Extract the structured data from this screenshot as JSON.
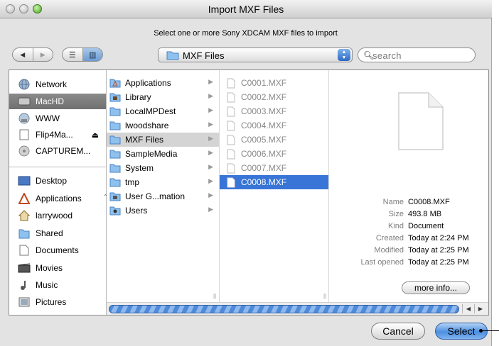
{
  "window": {
    "title": "Import MXF Files"
  },
  "message": "Select one or more Sony XDCAM MXF files to import",
  "toolbar": {
    "back_icon": "back-arrow-icon",
    "forward_icon": "forward-arrow-icon",
    "view_list_icon": "list-view-icon",
    "view_column_icon": "column-view-icon",
    "current_folder": "MXF Files",
    "search_placeholder": "search"
  },
  "sidebar": {
    "devices": [
      {
        "label": "Network",
        "icon": "network-globe-icon"
      },
      {
        "label": "MacHD",
        "icon": "hard-drive-icon",
        "selected": true
      },
      {
        "label": "WWW",
        "icon": "network-volume-icon"
      },
      {
        "label": "Flip4Ma...",
        "icon": "disk-image-icon",
        "eject": "⏏"
      },
      {
        "label": "CAPTUREM...",
        "icon": "drive-icon"
      }
    ],
    "places": [
      {
        "label": "Desktop",
        "icon": "desktop-icon"
      },
      {
        "label": "Applications",
        "icon": "applications-icon"
      },
      {
        "label": "larrywood",
        "icon": "home-icon"
      },
      {
        "label": "Shared",
        "icon": "folder-icon"
      },
      {
        "label": "Documents",
        "icon": "documents-icon"
      },
      {
        "label": "Movies",
        "icon": "movies-icon"
      },
      {
        "label": "Music",
        "icon": "music-icon"
      },
      {
        "label": "Pictures",
        "icon": "pictures-icon"
      }
    ]
  },
  "column1": [
    {
      "label": "Applications"
    },
    {
      "label": "Library"
    },
    {
      "label": "LocalMPDest"
    },
    {
      "label": "lwoodshare"
    },
    {
      "label": "MXF Files",
      "selected": true
    },
    {
      "label": "SampleMedia"
    },
    {
      "label": "System"
    },
    {
      "label": "tmp"
    },
    {
      "label": "User G...mation"
    },
    {
      "label": "Users"
    }
  ],
  "column2": [
    {
      "label": "C0001.MXF"
    },
    {
      "label": "C0002.MXF"
    },
    {
      "label": "C0003.MXF"
    },
    {
      "label": "C0004.MXF"
    },
    {
      "label": "C0005.MXF"
    },
    {
      "label": "C0006.MXF"
    },
    {
      "label": "C0007.MXF"
    },
    {
      "label": "C0008.MXF",
      "selected": true
    }
  ],
  "preview": {
    "info": [
      {
        "key": "Name",
        "value": "C0008.MXF"
      },
      {
        "key": "Size",
        "value": "493.8 MB"
      },
      {
        "key": "Kind",
        "value": "Document"
      },
      {
        "key": "Created",
        "value": "Today at 2:24 PM"
      },
      {
        "key": "Modified",
        "value": "Today at 2:25 PM"
      },
      {
        "key": "Last opened",
        "value": "Today at 2:25 PM"
      }
    ],
    "more_info_label": "more info..."
  },
  "buttons": {
    "cancel": "Cancel",
    "select": "Select"
  },
  "colors": {
    "selection_blue": "#3875d7",
    "sidebar_selected": "#7a7a7a"
  }
}
